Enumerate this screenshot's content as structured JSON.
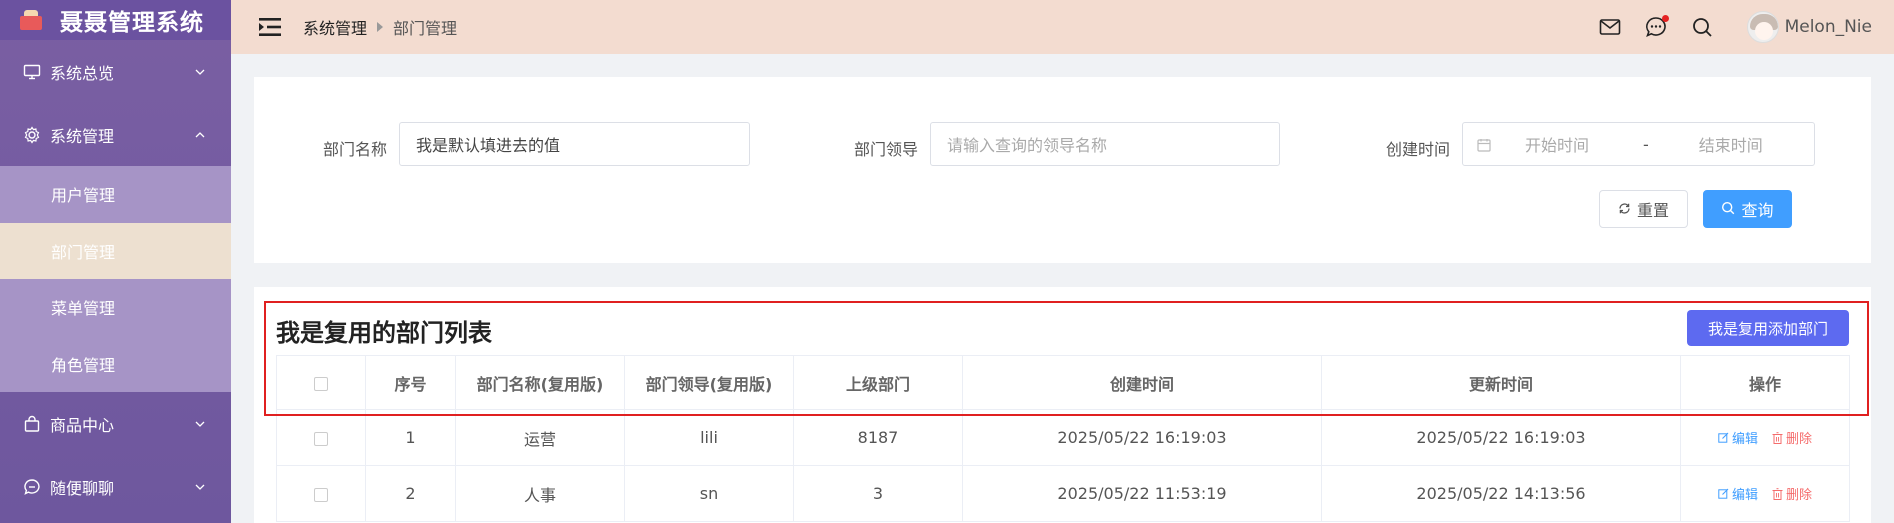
{
  "app": {
    "title": "聂聂管理系统"
  },
  "sidebar": {
    "items": [
      {
        "label": "系统总览",
        "icon": "monitor-icon",
        "expanded": false
      },
      {
        "label": "系统管理",
        "icon": "gear-icon",
        "expanded": true,
        "children": [
          {
            "label": "用户管理",
            "active": false
          },
          {
            "label": "部门管理",
            "active": true
          },
          {
            "label": "菜单管理",
            "active": false
          },
          {
            "label": "角色管理",
            "active": false
          }
        ]
      },
      {
        "label": "商品中心",
        "icon": "shopping-bag-icon",
        "expanded": false
      },
      {
        "label": "随便聊聊",
        "icon": "chat-bubble-icon",
        "expanded": false
      }
    ]
  },
  "header": {
    "breadcrumb": [
      "系统管理",
      "部门管理"
    ],
    "user": {
      "name": "Melon_Nie"
    },
    "has_notification": true
  },
  "search": {
    "dept_name_label": "部门名称",
    "dept_name_value": "我是默认填进去的值",
    "leader_label": "部门领导",
    "leader_placeholder": "请输入查询的领导名称",
    "create_time_label": "创建时间",
    "start_placeholder": "开始时间",
    "range_sep": "-",
    "end_placeholder": "结束时间",
    "reset_label": "重置",
    "query_label": "查询"
  },
  "table": {
    "title": "我是复用的部门列表",
    "add_label": "我是复用添加部门",
    "columns": [
      "序号",
      "部门名称(复用版)",
      "部门领导(复用版)",
      "上级部门",
      "创建时间",
      "更新时间",
      "操作"
    ],
    "rows": [
      {
        "index": "1",
        "name": "运营",
        "leader": "lili",
        "parent": "8187",
        "created": "2025/05/22 16:19:03",
        "updated": "2025/05/22 16:19:03"
      },
      {
        "index": "2",
        "name": "人事",
        "leader": "sn",
        "parent": "3",
        "created": "2025/05/22 11:53:19",
        "updated": "2025/05/22 14:13:56"
      }
    ],
    "edit_label": "编辑",
    "delete_label": "删除"
  },
  "colors": {
    "sidebar": "#6e579e",
    "submenu": "#a694c6",
    "active": "#ede0d0",
    "header": "#f3dcd0",
    "primary": "#409eff",
    "add": "#5d6af0",
    "danger": "#f56c6c",
    "highlight": "#e02020"
  }
}
